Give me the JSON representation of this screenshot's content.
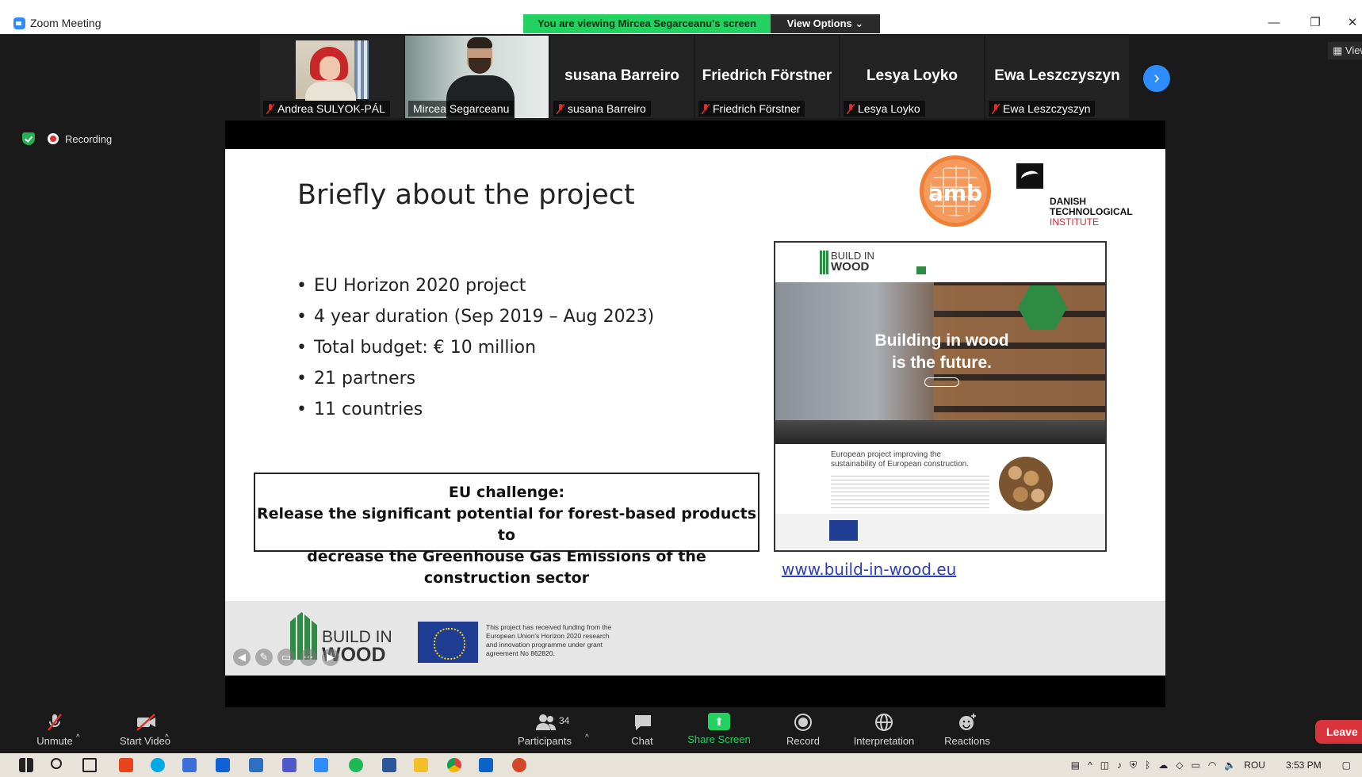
{
  "window": {
    "title": "Zoom Meeting",
    "minimize_icon": "minimize-icon",
    "restore_icon": "restore-icon",
    "close_icon": "close-icon"
  },
  "share_banner": {
    "viewing_text": "You are viewing Mircea Segarceanu's screen",
    "view_options_label": "View Options"
  },
  "view_button_label": "View",
  "participants_strip": [
    {
      "name": "Andrea SULYOK-PÁL",
      "video": true,
      "muted": true
    },
    {
      "name": "Mircea Segarceanu",
      "video": true,
      "muted": false,
      "active_speaker": true
    },
    {
      "name": "susana Barreiro",
      "video": false,
      "muted": true
    },
    {
      "name": "Friedrich Förstner",
      "video": false,
      "muted": true
    },
    {
      "name": "Lesya Loyko",
      "video": false,
      "muted": true
    },
    {
      "name": "Ewa Leszczyszyn",
      "video": false,
      "muted": true
    }
  ],
  "recording": {
    "label": "Recording"
  },
  "slide": {
    "heading": "Briefly about the project",
    "bullets": [
      "EU Horizon 2020 project",
      "4 year duration (Sep 2019 – Aug 2023)",
      "Total budget: € 10 million",
      "21 partners",
      "11 countries"
    ],
    "challenge_title": "EU challenge:",
    "challenge_line1": "Release the significant potential for forest-based products to",
    "challenge_line2": "decrease the Greenhouse Gas Emissions of the construction sector",
    "amb_logo_text": "amb",
    "dti_line1": "DANISH",
    "dti_line2": "TECHNOLOGICAL",
    "dti_line3": "INSTITUTE",
    "website": {
      "logo_line1": "BUILD IN",
      "logo_line2": "WOOD",
      "hero_line1": "Building in wood",
      "hero_line2": "is the future.",
      "about_text": "European project improving the sustainability of European construction."
    },
    "url": "www.build-in-wood.eu",
    "footer_logo_line1": "BUILD IN",
    "footer_logo_line2": "WOOD",
    "funding_text": "This project has received funding from the European Union's Horizon 2020 research and innovation programme under grant agreement No 862820."
  },
  "toolbar": {
    "unmute": "Unmute",
    "start_video": "Start Video",
    "participants": "Participants",
    "participants_count": "34",
    "chat": "Chat",
    "share_screen": "Share Screen",
    "record": "Record",
    "interpretation": "Interpretation",
    "reactions": "Reactions",
    "leave": "Leave"
  },
  "taskbar": {
    "language": "ROU",
    "time": "3:53 PM"
  },
  "colors": {
    "zoom_blue": "#2d8cff",
    "share_green": "#23d160",
    "leave_red": "#d9333b",
    "active_speaker": "#b5d334"
  }
}
